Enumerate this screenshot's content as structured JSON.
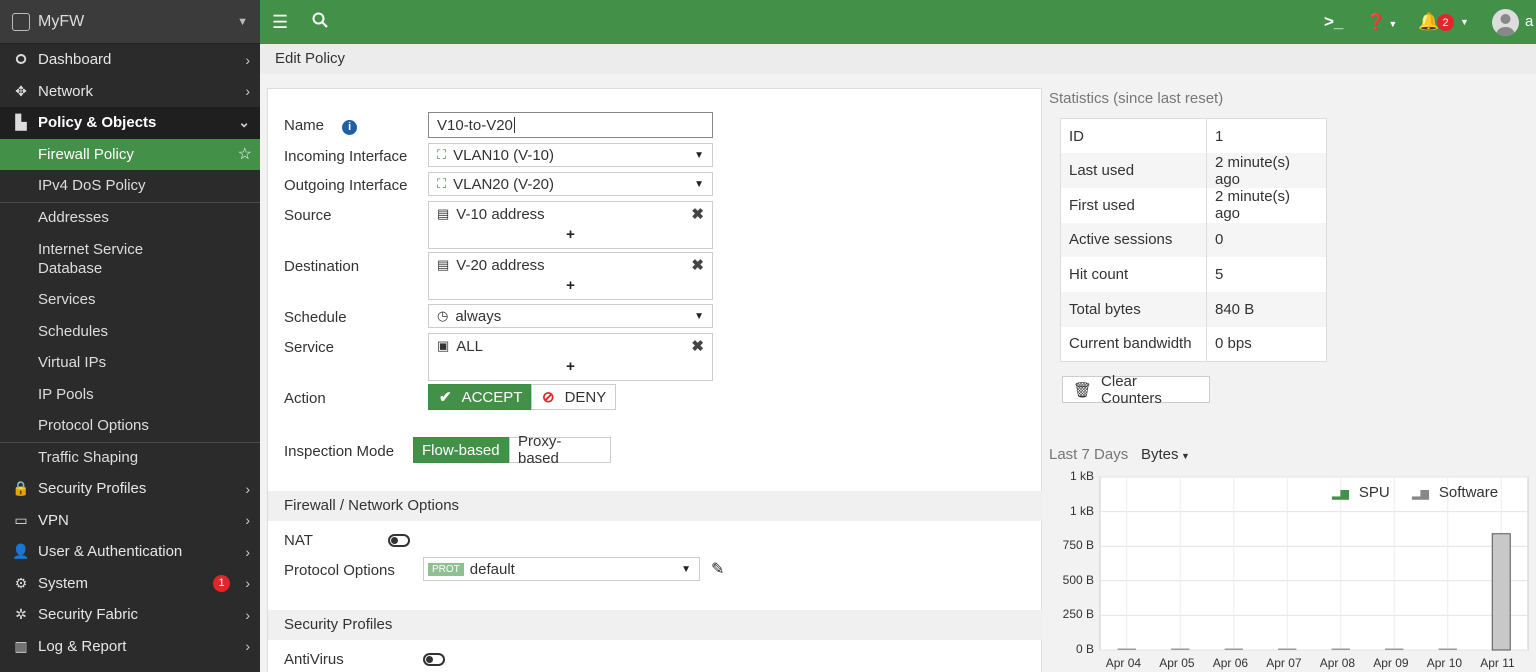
{
  "sidebar": {
    "brand": "MyFW",
    "items": [
      {
        "label": "Dashboard",
        "icon": "dashboard-icon",
        "glyph": "🞇"
      },
      {
        "label": "Network",
        "icon": "network-icon",
        "glyph": "✥"
      },
      {
        "label": "Policy & Objects",
        "icon": "policy-icon",
        "glyph": "▙"
      }
    ],
    "subitems": [
      "Firewall Policy",
      "IPv4 DoS Policy",
      "Addresses",
      "Internet Service Database",
      "Services",
      "Schedules",
      "Virtual IPs",
      "IP Pools",
      "Protocol Options",
      "Traffic Shaping"
    ],
    "bottom_items": [
      {
        "label": "Security Profiles",
        "icon": "lock-icon",
        "glyph": "🔒"
      },
      {
        "label": "VPN",
        "icon": "vpn-icon",
        "glyph": "▭"
      },
      {
        "label": "User & Authentication",
        "icon": "user-icon",
        "glyph": "👤"
      },
      {
        "label": "System",
        "icon": "gear-icon",
        "glyph": "⚙",
        "badge": "1"
      },
      {
        "label": "Security Fabric",
        "icon": "fabric-icon",
        "glyph": "✲"
      },
      {
        "label": "Log & Report",
        "icon": "chart-icon",
        "glyph": "▥"
      }
    ]
  },
  "topbar": {
    "notifications": "2",
    "user": "a"
  },
  "breadcrumb": "Edit Policy",
  "form": {
    "name_label": "Name",
    "name_value": "V10-to-V20",
    "incoming_label": "Incoming Interface",
    "incoming_value": "VLAN10 (V-10)",
    "outgoing_label": "Outgoing Interface",
    "outgoing_value": "VLAN20 (V-20)",
    "source_label": "Source",
    "source_value": "V-10 address",
    "destination_label": "Destination",
    "destination_value": "V-20 address",
    "schedule_label": "Schedule",
    "schedule_value": "always",
    "service_label": "Service",
    "service_value": "ALL",
    "action_label": "Action",
    "accept_label": "ACCEPT",
    "deny_label": "DENY",
    "inspection_label": "Inspection Mode",
    "flow_label": "Flow-based",
    "proxy_label": "Proxy-based",
    "fw_section": "Firewall / Network Options",
    "nat_label": "NAT",
    "protocol_label": "Protocol Options",
    "prot_badge": "PROT",
    "protocol_value": "default",
    "sec_section": "Security Profiles",
    "antivirus_label": "AntiVirus"
  },
  "stats": {
    "title": "Statistics (since last reset)",
    "rows": [
      {
        "k": "ID",
        "v": "1"
      },
      {
        "k": "Last used",
        "v": "2 minute(s) ago"
      },
      {
        "k": "First used",
        "v": "2 minute(s) ago"
      },
      {
        "k": "Active sessions",
        "v": "0"
      },
      {
        "k": "Hit count",
        "v": "5"
      },
      {
        "k": "Total bytes",
        "v": "840 B"
      },
      {
        "k": "Current bandwidth",
        "v": "0 bps"
      }
    ],
    "clear_label": "Clear Counters",
    "range_label": "Last 7 Days",
    "unit_label": "Bytes"
  },
  "chart_data": {
    "type": "bar",
    "categories": [
      "Apr 04",
      "Apr 05",
      "Apr 06",
      "Apr 07",
      "Apr 08",
      "Apr 09",
      "Apr 10",
      "Apr 11"
    ],
    "series": [
      {
        "name": "SPU",
        "color": "#439049",
        "values": [
          0,
          0,
          0,
          0,
          0,
          0,
          0,
          0
        ]
      },
      {
        "name": "Software",
        "color": "#9a9a9a",
        "values": [
          0,
          0,
          0,
          0,
          0,
          0,
          0,
          840
        ]
      }
    ],
    "ytick_labels": [
      "0 B",
      "250 B",
      "500 B",
      "750 B",
      "1 kB",
      "1 kB"
    ],
    "ytick_values": [
      0,
      250,
      500,
      750,
      1000,
      1250
    ],
    "ylim": [
      0,
      1250
    ]
  }
}
